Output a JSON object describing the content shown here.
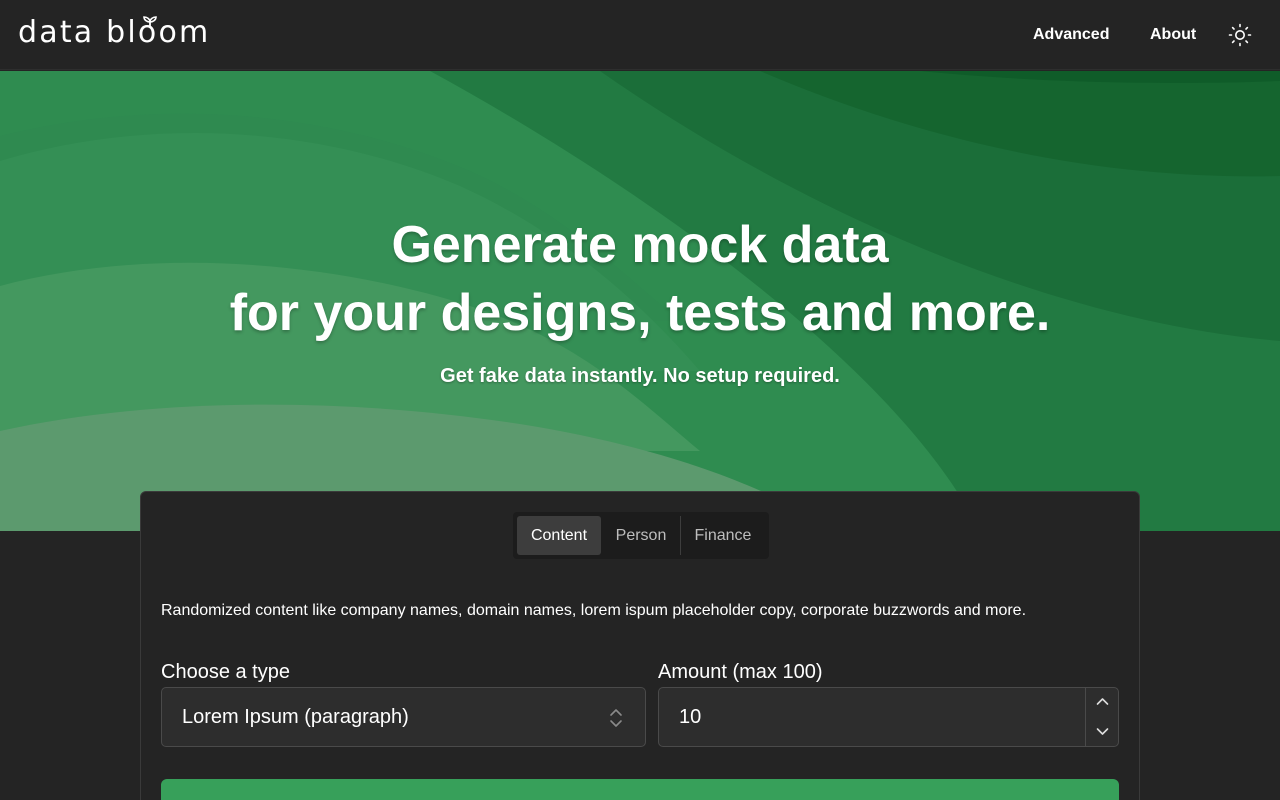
{
  "header": {
    "logo_text": "data bloom",
    "nav": [
      {
        "label": "Advanced"
      },
      {
        "label": "About"
      }
    ],
    "theme_icon": "sun-icon"
  },
  "hero": {
    "title_line1": "Generate mock data",
    "title_line2": "for your designs, tests and more.",
    "subtitle": "Get fake data instantly. No setup required."
  },
  "generator": {
    "tabs": [
      {
        "label": "Content",
        "active": true
      },
      {
        "label": "Person",
        "active": false
      },
      {
        "label": "Finance",
        "active": false
      }
    ],
    "description": "Randomized content like company names, domain names, lorem ispum placeholder copy, corporate buzzwords and more.",
    "type_label": "Choose a type",
    "type_value": "Lorem Ipsum (paragraph)",
    "amount_label": "Amount (max 100)",
    "amount_value": "10"
  },
  "colors": {
    "background": "#242424",
    "hero_green": "#2f8c50",
    "button_green": "#37a05a"
  }
}
